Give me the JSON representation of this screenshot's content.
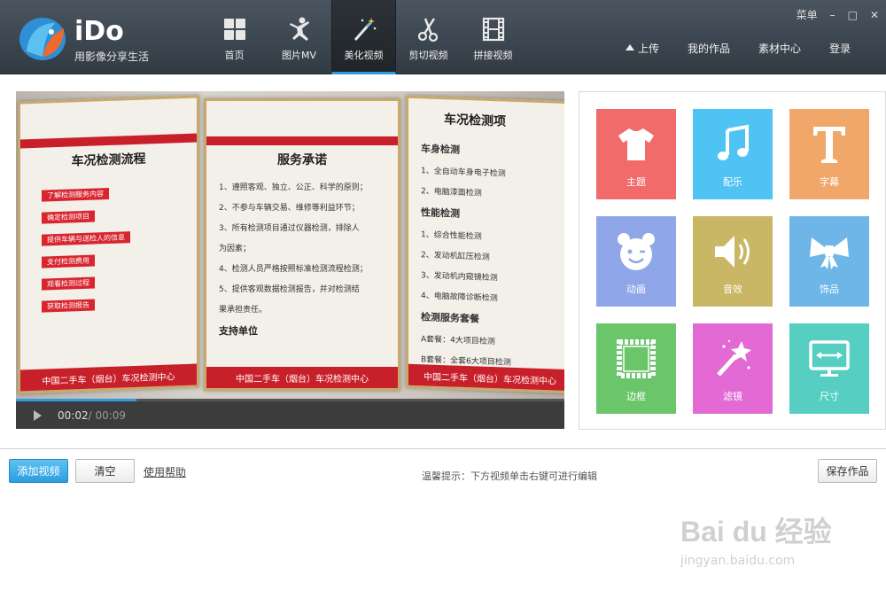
{
  "app": {
    "brand": "iDo",
    "slogan": "用影像分享生活"
  },
  "nav": [
    {
      "label": "首页",
      "icon": "home-grid-icon"
    },
    {
      "label": "图片MV",
      "icon": "dancer-icon"
    },
    {
      "label": "美化视频",
      "icon": "magic-wand-icon",
      "active": true
    },
    {
      "label": "剪切视频",
      "icon": "scissors-icon"
    },
    {
      "label": "拼接视频",
      "icon": "film-strip-icon"
    }
  ],
  "window": {
    "menu": "菜单",
    "minimize": "–",
    "maximize": "□",
    "close": "✕"
  },
  "header_links": {
    "upload": "上传",
    "my_works": "我的作品",
    "material": "素材中心",
    "login": "登录"
  },
  "player": {
    "current": "00:02",
    "duration": " / 00:09",
    "progress": 0.22
  },
  "poster": {
    "left_title": "车况检测流程",
    "left_tags": [
      "了解检测服务内容",
      "确定检测项目",
      "提供车辆与送检人的信息",
      "支付检测费用",
      "观看检测过程",
      "获取检测报告"
    ],
    "middle_title": "服务承诺",
    "middle_lines": [
      "1、遵照客观、独立、公正、科学的原则；",
      "2、不参与车辆交易、维修等利益环节；",
      "3、所有检测项目通过仪器检测，排除人",
      "为因素；",
      "4、检测人员严格按照标准检测流程检测；",
      "5、提供客观数据检测报告，并对检测结",
      "果承担责任。"
    ],
    "middle_sub": "支持单位",
    "right_title": "车况检测项",
    "right_lines": [
      "车身检测",
      "1、全自动车身电子检测",
      "2、电脑漆面检测",
      "性能检测",
      "1、综合性能检测",
      "2、发动机缸压检测",
      "3、发动机内窥镜检测",
      "4、电脑故障诊断检测",
      "检测服务套餐",
      "A套餐：4大项目检测",
      "B套餐：全套6大项目检测"
    ],
    "footer": "中国二手车（烟台）车况检测中心"
  },
  "tools": [
    {
      "label": "主题",
      "color": "#f26b6b",
      "icon": "tshirt-icon"
    },
    {
      "label": "配乐",
      "color": "#4fc3f3",
      "icon": "music-note-icon"
    },
    {
      "label": "字幕",
      "color": "#f2a76a",
      "icon": "letter-t-icon"
    },
    {
      "label": "动画",
      "color": "#8fa6e8",
      "icon": "bear-face-icon"
    },
    {
      "label": "音效",
      "color": "#c9b765",
      "icon": "speaker-icon"
    },
    {
      "label": "饰品",
      "color": "#6fb6e8",
      "icon": "bow-icon"
    },
    {
      "label": "边框",
      "color": "#6bc56b",
      "icon": "frame-icon"
    },
    {
      "label": "滤镜",
      "color": "#e36ad4",
      "icon": "wand-star-icon"
    },
    {
      "label": "尺寸",
      "color": "#56cfc2",
      "icon": "monitor-icon"
    }
  ],
  "bottom": {
    "add_video": "添加视频",
    "clear": "清空",
    "help": "使用帮助",
    "tip": "温馨提示：下方视频单击右键可进行编辑",
    "save": "保存作品"
  },
  "watermark": {
    "title": "Bai du 经验",
    "url": "jingyan.baidu.com"
  }
}
